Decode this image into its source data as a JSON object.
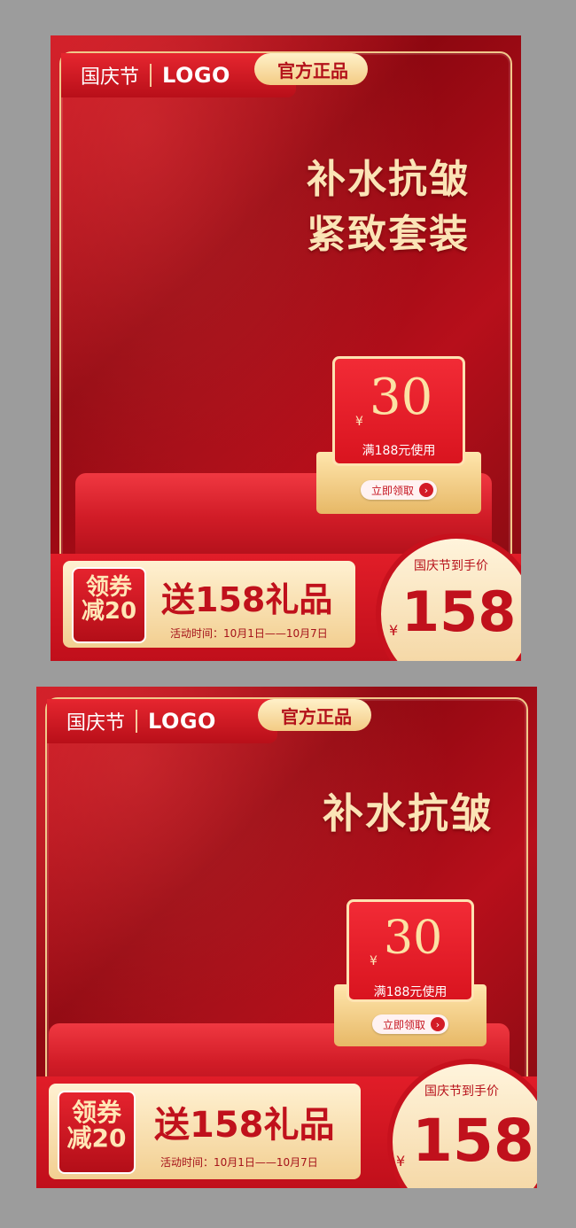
{
  "card1": {
    "holiday_label": "国庆节",
    "logo_text": "LOGO",
    "official_badge": "官方正品",
    "headline_line1": "补水抗皱",
    "headline_line2": "紧致套装",
    "coupon": {
      "currency": "¥",
      "amount": "30",
      "condition": "满188元使用",
      "button_label": "立即领取",
      "button_arrow": "›"
    },
    "redeem_line1": "领券",
    "redeem_line2": "减20",
    "gift_text": "送158礼品",
    "event_date": "活动时间：10月1日——10月7日",
    "price_label": "国庆节到手价",
    "price_currency": "¥",
    "price_value": "158"
  },
  "card2": {
    "holiday_label": "国庆节",
    "logo_text": "LOGO",
    "official_badge": "官方正品",
    "headline_line1": "补水抗皱",
    "coupon": {
      "currency": "¥",
      "amount": "30",
      "condition": "满188元使用",
      "button_label": "立即领取",
      "button_arrow": "›"
    },
    "redeem_line1": "领券",
    "redeem_line2": "减20",
    "gift_text": "送158礼品",
    "event_date": "活动时间：10月1日——10月7日",
    "price_label": "国庆节到手价",
    "price_currency": "¥",
    "price_value": "158"
  },
  "colors": {
    "page_bg": "#9c9c9c",
    "primary_red": "#c81420",
    "gold": "#f3cb84",
    "headline_gold": "#fbe4b6"
  }
}
